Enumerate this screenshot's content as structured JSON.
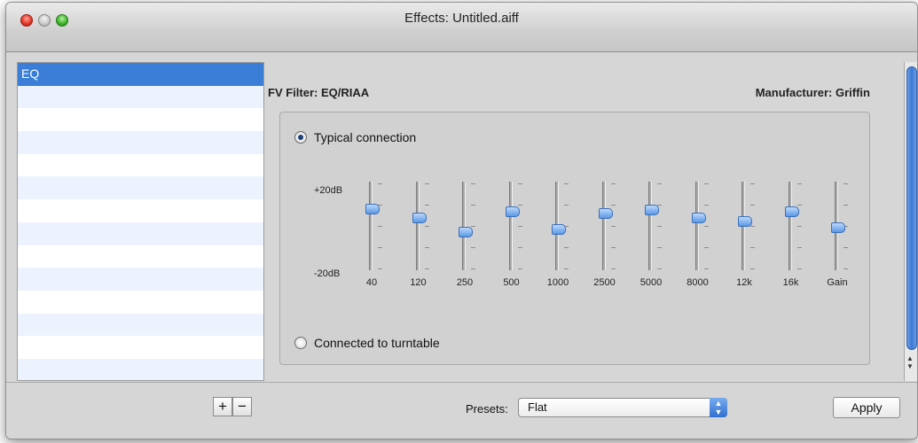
{
  "window": {
    "title": "Effects: Untitled.aiff"
  },
  "sidebar": {
    "items": [
      {
        "label": "EQ",
        "selected": true
      },
      {
        "label": ""
      },
      {
        "label": ""
      },
      {
        "label": ""
      },
      {
        "label": ""
      },
      {
        "label": ""
      },
      {
        "label": ""
      },
      {
        "label": ""
      },
      {
        "label": ""
      },
      {
        "label": ""
      },
      {
        "label": ""
      },
      {
        "label": ""
      },
      {
        "label": ""
      },
      {
        "label": ""
      }
    ]
  },
  "panel": {
    "filter": "FV Filter: EQ/RIAA",
    "manufacturer": "Manufacturer: Griffin",
    "radio_typical": "Typical connection",
    "radio_turntable": "Connected to turntable",
    "db_top": "+20dB",
    "db_bottom": "-20dB",
    "bands": [
      {
        "label": "40",
        "level": 0.72
      },
      {
        "label": "120",
        "level": 0.6
      },
      {
        "label": "250",
        "level": 0.42
      },
      {
        "label": "500",
        "level": 0.68
      },
      {
        "label": "1000",
        "level": 0.45
      },
      {
        "label": "2500",
        "level": 0.66
      },
      {
        "label": "5000",
        "level": 0.7
      },
      {
        "label": "8000",
        "level": 0.6
      },
      {
        "label": "12k",
        "level": 0.56
      },
      {
        "label": "16k",
        "level": 0.68
      },
      {
        "label": "Gain",
        "level": 0.48
      }
    ]
  },
  "bottom": {
    "add": "+",
    "remove": "−",
    "presets_label": "Presets:",
    "presets_value": "Flat",
    "apply": "Apply"
  }
}
